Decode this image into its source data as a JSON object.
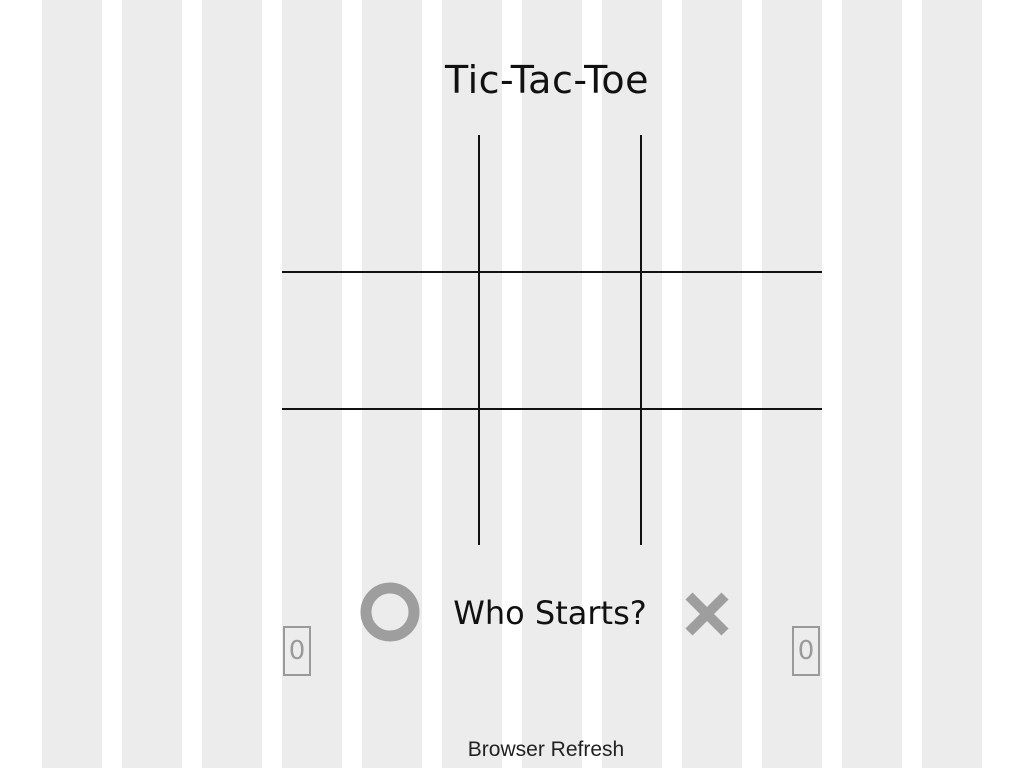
{
  "game": {
    "title": "Tic-Tac-Toe",
    "prompt": "Who Starts?",
    "footer_link": "Browser Refresh",
    "board": [
      "",
      "",
      "",
      "",
      "",
      "",
      "",
      "",
      ""
    ],
    "score_o": "0",
    "score_x": "0",
    "o_icon": "o-mark-icon",
    "x_icon": "x-mark-icon"
  },
  "colors": {
    "background_stripe": "#ececec",
    "grid_line": "#111111",
    "token_gray": "#9e9e9e",
    "text": "#111111"
  }
}
